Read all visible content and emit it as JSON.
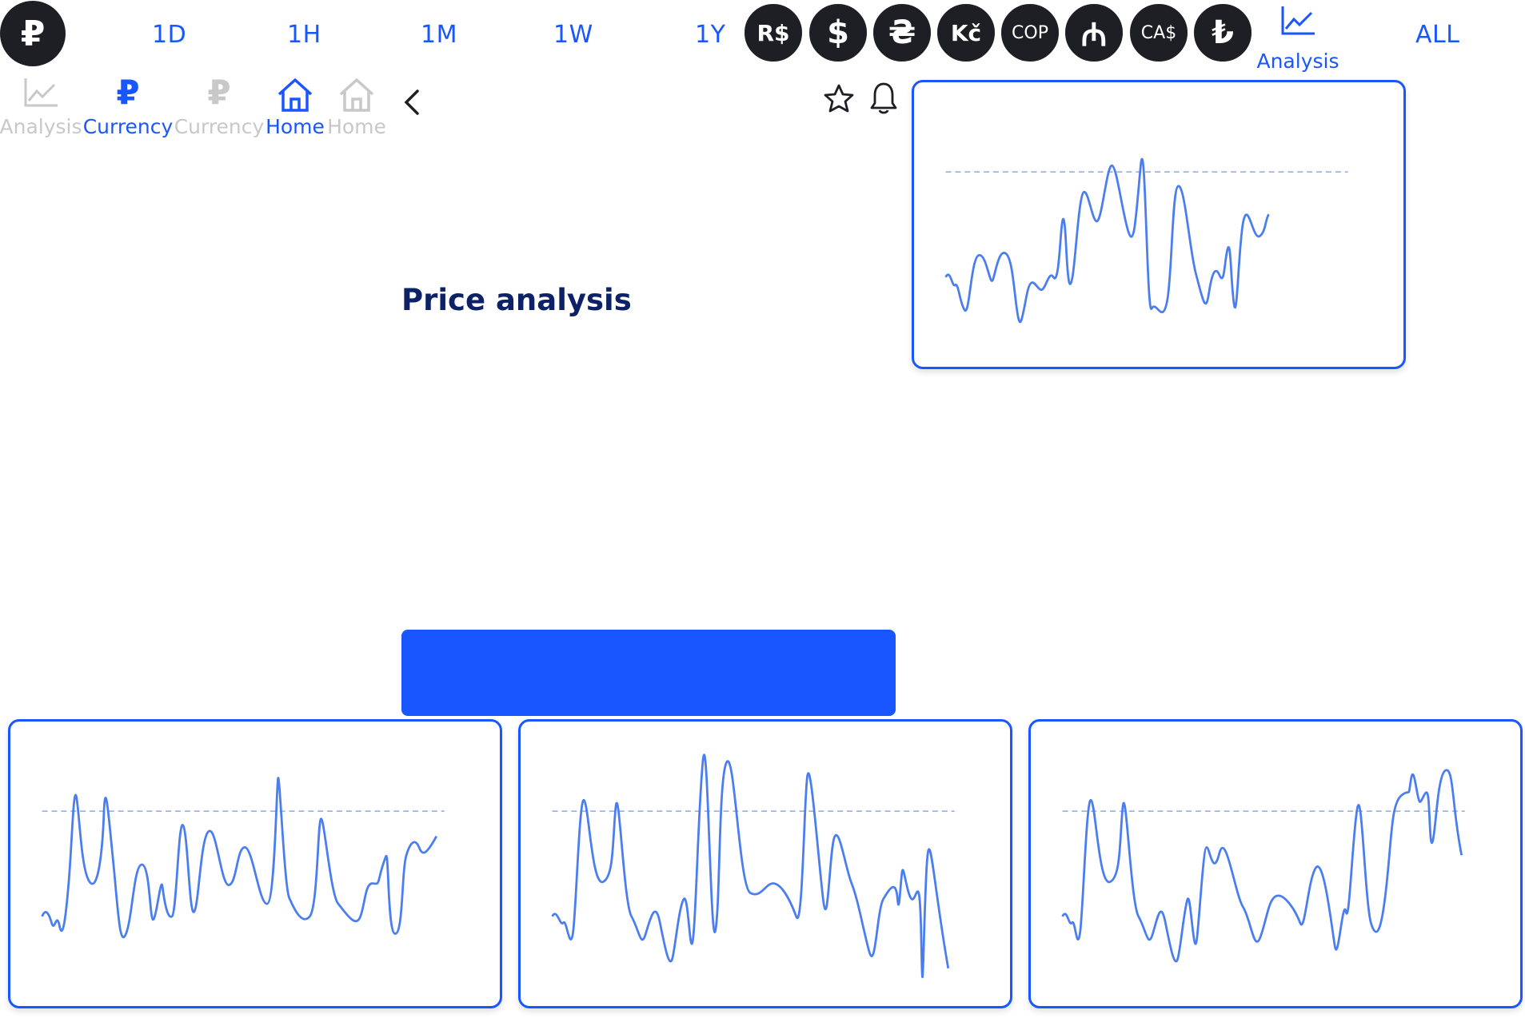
{
  "header": {
    "main_currency_symbol": "₽",
    "periods": [
      "1D",
      "1H",
      "1M",
      "1W",
      "1Y"
    ],
    "currency_chips": [
      "R$",
      "$",
      "₴",
      "Kč",
      "COP",
      "₼",
      "CA$",
      "₺"
    ],
    "analysis_label": "Analysis",
    "all_label": "ALL"
  },
  "tabs": [
    {
      "label": "Analysis",
      "state": "inactive",
      "icon": "chart-line-icon"
    },
    {
      "label": "Currency",
      "state": "active",
      "icon": "ruble-icon"
    },
    {
      "label": "Currency",
      "state": "inactive",
      "icon": "ruble-icon"
    },
    {
      "label": "Home",
      "state": "active",
      "icon": "home-icon"
    },
    {
      "label": "Home",
      "state": "inactive",
      "icon": "home-icon"
    }
  ],
  "page": {
    "title": "Price analysis"
  },
  "colors": {
    "accent": "#1a56ff",
    "dark": "#1d1f24",
    "muted": "#c8c8c8",
    "title": "#0d2266"
  }
}
